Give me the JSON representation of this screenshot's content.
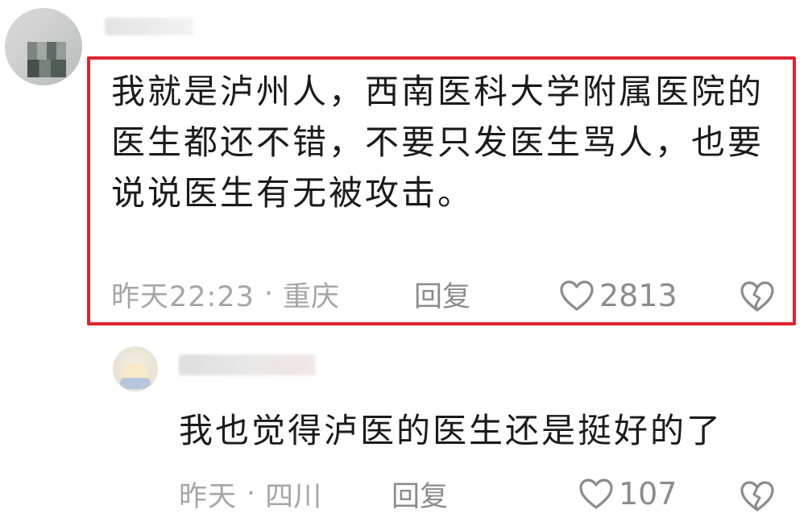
{
  "main_comment": {
    "text": "我就是泸州人，西南医科大学附属医院的医生都还不错，不要只发医生骂人，也要说说医生有无被攻击。",
    "time": "昨天22:23",
    "separator": "·",
    "location": "重庆",
    "reply_label": "回复",
    "likes": "2813",
    "highlight_color": "#e0232f"
  },
  "reply_comment": {
    "text": "我也觉得泸医的医生还是挺好的了",
    "time": "昨天",
    "separator": "·",
    "location": "四川",
    "reply_label": "回复",
    "likes": "107"
  },
  "icons": {
    "like": "heart-outline-icon",
    "dislike": "broken-heart-icon"
  },
  "colors": {
    "text": "#1b1b1b",
    "meta": "#a6a6a6",
    "icon": "#8c8c8c"
  }
}
